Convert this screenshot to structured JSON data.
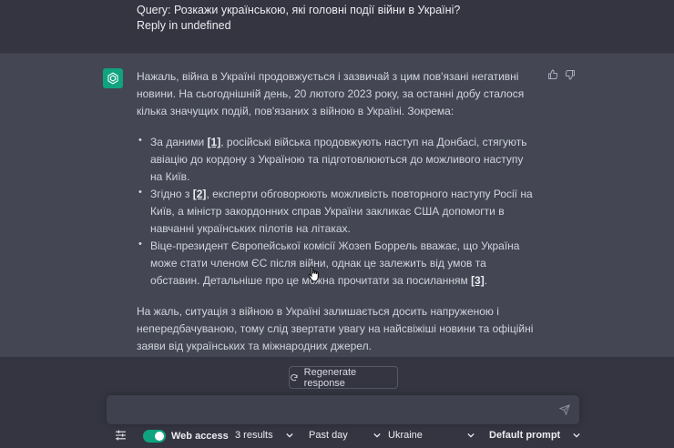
{
  "user_message": {
    "query_line": "Query: Розкажи українською, які головні події війни в Україні?",
    "reply_line": "Reply in undefined"
  },
  "assistant_message": {
    "intro": "Нажаль, війна в Україні продовжується і зазвичай з цим пов'язані негативні новини. На сьогоднішній день, 20 лютого 2023 року, за останні добу сталося кілька значущих подій, пов'язаних з війною в Україні. Зокрема:",
    "bullets": [
      {
        "before": "За даними ",
        "ref": "[1]",
        "after": ", російські війська продовжують наступ на Донбасі, стягують авіацію до кордону з Україною та підготовлюються до можливого наступу на Київ."
      },
      {
        "before": "Згідно з ",
        "ref": "[2]",
        "after": ", експерти обговорюють можливість повторного наступу Росії на Київ, а міністр закордонних справ України закликає США допомогти в навчанні українських пілотів на літаках."
      },
      {
        "before": "Віце-президент Європейської комісії Жозеп Боррель вважає, що Україна може стати членом ЄС після війни, однак це залежить від умов та обставин. Детальніше про це можна прочитати за посиланням ",
        "ref": "[3]",
        "after": "."
      }
    ],
    "outro": "На жаль, ситуація з війною в Україні залишається досить напруженою і непередбачуваною, тому слід звертати увагу на найсвіжіші новини та офіційні заяви від українських та міжнародних джерел."
  },
  "regenerate_label": "Regenerate response",
  "toolbar": {
    "web_access_label": "Web access",
    "results": "3 results",
    "time_range": "Past day",
    "region": "Ukraine",
    "prompt": "Default prompt"
  },
  "colors": {
    "background": "#343541",
    "assistant_background": "#444654",
    "accent": "#10a37f"
  }
}
